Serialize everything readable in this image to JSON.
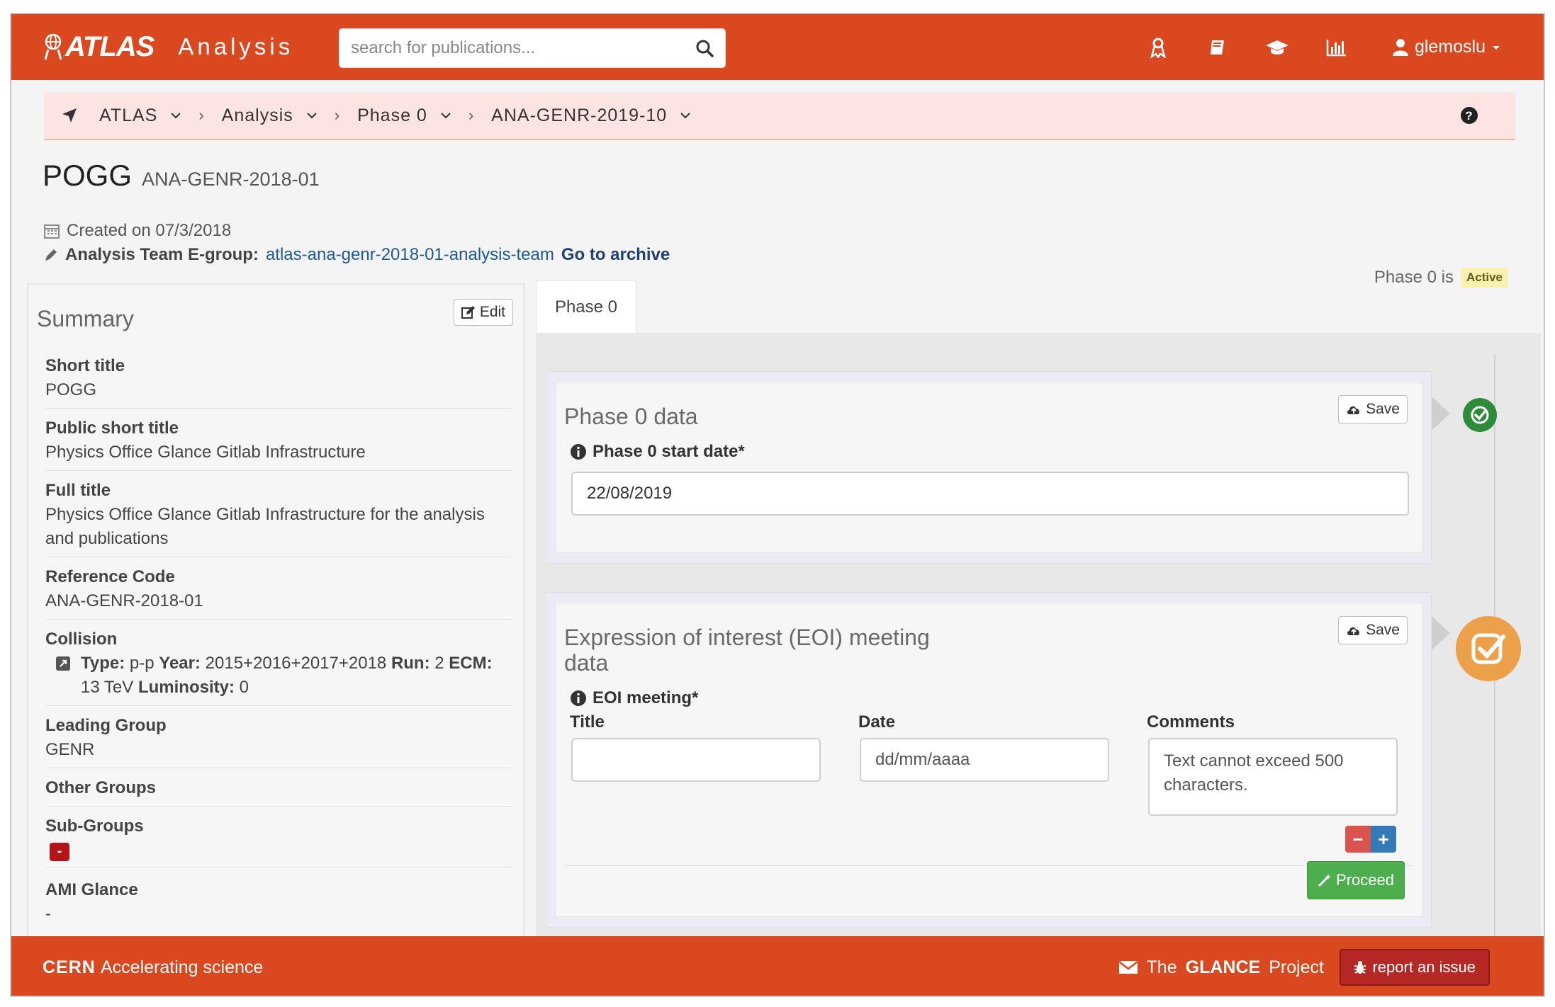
{
  "navbar": {
    "logo_text": "ATLAS",
    "app_name": "Analysis",
    "search_placeholder": "search for publications...",
    "username": "glemoslu",
    "icons": [
      "ribbon-icon",
      "book-icon",
      "graduation-cap-icon",
      "bar-chart-icon",
      "user-icon"
    ]
  },
  "breadcrumb": {
    "items": [
      "ATLAS",
      "Analysis",
      "Phase 0",
      "ANA-GENR-2019-10"
    ]
  },
  "page": {
    "title": "POGG",
    "code": "ANA-GENR-2018-01",
    "created": "Created on 07/3/2018",
    "egroup_label": "Analysis Team E-group:",
    "egroup_value": "atlas-ana-genr-2018-01-analysis-team",
    "archive_link": "Go to archive",
    "phase_status_text": "Phase 0 is",
    "phase_status_badge": "Active"
  },
  "summary": {
    "heading": "Summary",
    "edit_label": "Edit",
    "fields": [
      {
        "label": "Short title",
        "value": "POGG"
      },
      {
        "label": "Public short title",
        "value": "Physics Office Glance Gitlab Infrastructure"
      },
      {
        "label": "Full title",
        "value": "Physics Office Glance Gitlab Infrastructure for the analysis and publications"
      },
      {
        "label": "Reference Code",
        "value": "ANA-GENR-2018-01"
      },
      {
        "label": "Collision",
        "type_label": "Type:",
        "type": "p-p",
        "year_label": "Year:",
        "year": "2015+2016+2017+2018",
        "run_label": "Run:",
        "run": "2",
        "ecm_label": "ECM:",
        "ecm": "13 TeV",
        "lumi_label": "Luminosity:",
        "lumi": "0"
      },
      {
        "label": "Leading Group",
        "value": "GENR"
      },
      {
        "label": "Other Groups",
        "value": ""
      },
      {
        "label": "Sub-Groups",
        "badge": "-"
      },
      {
        "label": "AMI Glance",
        "value": "-"
      }
    ]
  },
  "tabs": [
    {
      "label": "Phase 0"
    }
  ],
  "phase0_panel": {
    "title": "Phase 0 data",
    "save_label": "Save",
    "start_date_label": "Phase 0 start date*",
    "start_date_value": "22/08/2019"
  },
  "eoi_panel": {
    "title_line1": "Expression of interest (EOI) meeting",
    "title_line2": "data",
    "save_label": "Save",
    "meeting_label": "EOI meeting*",
    "col_title": "Title",
    "col_date": "Date",
    "col_comments": "Comments",
    "title_value": "",
    "date_placeholder": "dd/mm/aaaa",
    "comments_placeholder": "Text cannot exceed 500 characters.",
    "remove_label": "−",
    "add_label": "+",
    "proceed_label": "Proceed"
  },
  "footer": {
    "org": "CERN",
    "tagline": "Accelerating science",
    "project_prefix": "The",
    "project_bold": "GLANCE",
    "project_suffix": "Project",
    "report_label": "report an issue"
  },
  "colors": {
    "brand": "#d9481f",
    "success": "#2e8b3a",
    "pending": "#eda04a",
    "danger": "#b52825",
    "link": "#1d5a95"
  }
}
